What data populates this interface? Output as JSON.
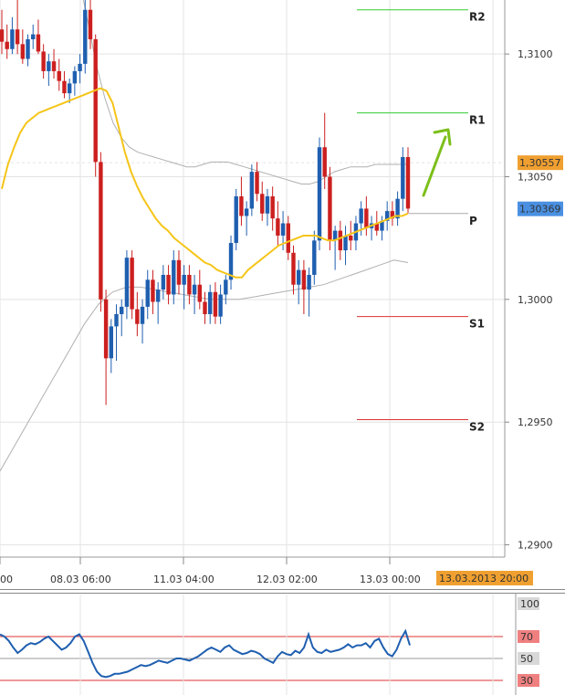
{
  "chart_data": {
    "type": "candlestick",
    "main_panel": {
      "y_axis_labels": [
        "1,3100",
        "1,3050",
        "1,3000",
        "1,2950",
        "1,2900"
      ],
      "y_axis_values": [
        1.31,
        1.305,
        1.3,
        1.295,
        1.29
      ],
      "ylim": [
        1.2895,
        1.3122
      ],
      "x_axis_labels": [
        "00",
        "08.03 06:00",
        "11.03 04:00",
        "12.03 02:00",
        "13.03 00:00"
      ],
      "current_time_label": "13.03.2013 20:00",
      "price_badges": [
        {
          "label": "1,30557",
          "value": 1.30557,
          "color": "#f0a030"
        },
        {
          "label": "1,30369",
          "value": 1.30369,
          "color": "#4a90e2"
        }
      ],
      "pivot_levels": [
        {
          "name": "R2",
          "value": 1.3118,
          "color": "#33cc33"
        },
        {
          "name": "R1",
          "value": 1.3076,
          "color": "#33cc33"
        },
        {
          "name": "P",
          "value": 1.3035,
          "color": "#aaaaaa"
        },
        {
          "name": "S1",
          "value": 1.2993,
          "color": "#dd3333"
        },
        {
          "name": "S2",
          "value": 1.2951,
          "color": "#dd3333"
        }
      ],
      "candles_ohlc": [
        [
          1.311,
          1.3118,
          1.31,
          1.3105
        ],
        [
          1.3105,
          1.3112,
          1.3098,
          1.3102
        ],
        [
          1.3102,
          1.3115,
          1.31,
          1.311
        ],
        [
          1.311,
          1.3122,
          1.31,
          1.3104
        ],
        [
          1.3104,
          1.311,
          1.3096,
          1.3098
        ],
        [
          1.3098,
          1.3108,
          1.3095,
          1.3106
        ],
        [
          1.3106,
          1.3112,
          1.3102,
          1.3108
        ],
        [
          1.3108,
          1.3114,
          1.31,
          1.3101
        ],
        [
          1.3101,
          1.3104,
          1.309,
          1.3093
        ],
        [
          1.3093,
          1.31,
          1.3087,
          1.3097
        ],
        [
          1.3097,
          1.3102,
          1.309,
          1.3093
        ],
        [
          1.3093,
          1.3098,
          1.3085,
          1.3089
        ],
        [
          1.3089,
          1.3093,
          1.3082,
          1.3084
        ],
        [
          1.3084,
          1.309,
          1.308,
          1.3088
        ],
        [
          1.3088,
          1.3095,
          1.3083,
          1.3093
        ],
        [
          1.3093,
          1.31,
          1.3088,
          1.3096
        ],
        [
          1.3096,
          1.3122,
          1.3092,
          1.3118
        ],
        [
          1.3118,
          1.3122,
          1.3102,
          1.3106
        ],
        [
          1.3106,
          1.3108,
          1.305,
          1.3056
        ],
        [
          1.3056,
          1.306,
          1.2995,
          1.3
        ],
        [
          1.3,
          1.3004,
          1.2957,
          1.2976
        ],
        [
          1.2976,
          1.2992,
          1.297,
          1.2989
        ],
        [
          1.2989,
          1.2998,
          1.2975,
          1.2994
        ],
        [
          1.2994,
          1.3,
          1.2985,
          1.2997
        ],
        [
          1.2997,
          1.302,
          1.2992,
          1.3017
        ],
        [
          1.3017,
          1.302,
          1.2992,
          1.2996
        ],
        [
          1.2996,
          1.3003,
          1.2985,
          1.299
        ],
        [
          1.299,
          1.3,
          1.2982,
          1.2997
        ],
        [
          1.2997,
          1.3012,
          1.2992,
          1.3008
        ],
        [
          1.3008,
          1.3012,
          1.2994,
          1.2999
        ],
        [
          1.2999,
          1.3007,
          1.299,
          1.3004
        ],
        [
          1.3004,
          1.3014,
          1.3,
          1.301
        ],
        [
          1.301,
          1.3014,
          1.2998,
          1.3002
        ],
        [
          1.3002,
          1.302,
          1.2998,
          1.3016
        ],
        [
          1.3016,
          1.302,
          1.3002,
          1.3006
        ],
        [
          1.3006,
          1.3014,
          1.2996,
          1.301
        ],
        [
          1.301,
          1.3014,
          1.2998,
          1.3002
        ],
        [
          1.3002,
          1.301,
          1.2994,
          1.3006
        ],
        [
          1.3006,
          1.3012,
          1.2996,
          1.2999
        ],
        [
          1.2999,
          1.3003,
          1.299,
          1.2994
        ],
        [
          1.2994,
          1.3006,
          1.299,
          1.3003
        ],
        [
          1.3003,
          1.3007,
          1.299,
          1.2993
        ],
        [
          1.2993,
          1.3006,
          1.299,
          1.3002
        ],
        [
          1.3002,
          1.301,
          1.2998,
          1.3008
        ],
        [
          1.3008,
          1.3026,
          1.3004,
          1.3023
        ],
        [
          1.3023,
          1.3045,
          1.302,
          1.3042
        ],
        [
          1.3042,
          1.305,
          1.303,
          1.3034
        ],
        [
          1.3034,
          1.304,
          1.3026,
          1.3037
        ],
        [
          1.3037,
          1.3055,
          1.3034,
          1.3052
        ],
        [
          1.3052,
          1.3056,
          1.304,
          1.3043
        ],
        [
          1.3043,
          1.3048,
          1.3032,
          1.3035
        ],
        [
          1.3035,
          1.3045,
          1.303,
          1.3042
        ],
        [
          1.3042,
          1.3046,
          1.3028,
          1.3033
        ],
        [
          1.3033,
          1.304,
          1.3022,
          1.3026
        ],
        [
          1.3026,
          1.3036,
          1.302,
          1.3031
        ],
        [
          1.3031,
          1.3034,
          1.3016,
          1.3019
        ],
        [
          1.3019,
          1.3022,
          1.3002,
          1.3006
        ],
        [
          1.3006,
          1.3016,
          1.2998,
          1.3012
        ],
        [
          1.3012,
          1.3016,
          1.2994,
          1.3004
        ],
        [
          1.3004,
          1.3013,
          1.2993,
          1.301
        ],
        [
          1.301,
          1.3028,
          1.3006,
          1.3024
        ],
        [
          1.3024,
          1.3066,
          1.302,
          1.3062
        ],
        [
          1.3062,
          1.3076,
          1.3045,
          1.305
        ],
        [
          1.305,
          1.3054,
          1.302,
          1.3024
        ],
        [
          1.3024,
          1.303,
          1.3012,
          1.3028
        ],
        [
          1.3028,
          1.3032,
          1.3016,
          1.302
        ],
        [
          1.302,
          1.303,
          1.3014,
          1.3026
        ],
        [
          1.3026,
          1.3032,
          1.302,
          1.3024
        ],
        [
          1.3024,
          1.3034,
          1.302,
          1.3031
        ],
        [
          1.3031,
          1.304,
          1.3026,
          1.3037
        ],
        [
          1.3037,
          1.3042,
          1.3026,
          1.3029
        ],
        [
          1.3029,
          1.3034,
          1.3024,
          1.3031
        ],
        [
          1.3031,
          1.3036,
          1.3026,
          1.3028
        ],
        [
          1.3028,
          1.3034,
          1.3024,
          1.3032
        ],
        [
          1.3032,
          1.304,
          1.3028,
          1.3036
        ],
        [
          1.3036,
          1.304,
          1.303,
          1.3033
        ],
        [
          1.3033,
          1.3044,
          1.303,
          1.3041
        ],
        [
          1.3041,
          1.3062,
          1.3036,
          1.3058
        ],
        [
          1.3058,
          1.3062,
          1.3035,
          1.3037
        ]
      ],
      "moving_average": [
        1.3045,
        1.3055,
        1.3062,
        1.3068,
        1.3072,
        1.3074,
        1.3076,
        1.3077,
        1.3078,
        1.3079,
        1.308,
        1.3081,
        1.3082,
        1.3083,
        1.3084,
        1.3085,
        1.3086,
        1.3085,
        1.308,
        1.307,
        1.306,
        1.3052,
        1.3046,
        1.3041,
        1.3037,
        1.3033,
        1.303,
        1.3028,
        1.3025,
        1.3023,
        1.3021,
        1.3019,
        1.3017,
        1.3015,
        1.3014,
        1.3012,
        1.3011,
        1.301,
        1.3009,
        1.3009,
        1.3012,
        1.3014,
        1.3016,
        1.3018,
        1.302,
        1.3022,
        1.3023,
        1.3024,
        1.3025,
        1.3026,
        1.3026,
        1.3026,
        1.3025,
        1.3024,
        1.3024,
        1.3025,
        1.3026,
        1.3027,
        1.3028,
        1.3029,
        1.303,
        1.3031,
        1.3032,
        1.3033,
        1.3034,
        1.3034,
        1.3035
      ],
      "bollinger_upper": [
        1.315,
        1.314,
        1.3128,
        1.3112,
        1.3095,
        1.3082,
        1.3072,
        1.3066,
        1.3062,
        1.306,
        1.3059,
        1.3058,
        1.3057,
        1.3056,
        1.3055,
        1.3054,
        1.3054,
        1.3055,
        1.3056,
        1.3056,
        1.3056,
        1.3055,
        1.3054,
        1.3053,
        1.3052,
        1.3051,
        1.305,
        1.3049,
        1.3048,
        1.3047,
        1.3047,
        1.3048,
        1.305,
        1.3052,
        1.3053,
        1.3054,
        1.3054,
        1.3054,
        1.3055,
        1.3055,
        1.3055,
        1.3055,
        1.3055
      ],
      "bollinger_lower": [
        1.293,
        1.294,
        1.295,
        1.296,
        1.297,
        1.298,
        1.299,
        1.2998,
        1.3003,
        1.3005,
        1.3005,
        1.3004,
        1.3003,
        1.3002,
        1.3001,
        1.3,
        1.3,
        1.3,
        1.3001,
        1.3002,
        1.3003,
        1.3004,
        1.3005,
        1.3006,
        1.3008,
        1.301,
        1.3012,
        1.3014,
        1.3016,
        1.3015
      ],
      "colors": {
        "up": "#1f5fb0",
        "down": "#cc1f1f",
        "ma": "#f5c518",
        "bollinger": "#b0b0b0",
        "arrow": "#7cbf1a"
      }
    },
    "oscillator_panel": {
      "y_axis_labels": [
        "100",
        "70",
        "50",
        "30"
      ],
      "ylim": [
        30,
        100
      ],
      "levels": [
        {
          "label": "70",
          "value": 70,
          "color": "#dd3333",
          "badge_color": "#f08080"
        },
        {
          "label": "50",
          "value": 50,
          "color": "#999999",
          "badge_color": "#d8d8d8"
        },
        {
          "label": "30",
          "value": 30,
          "color": "#dd3333",
          "badge_color": "#f08080"
        }
      ],
      "badge_100_color": "#d8d8d8",
      "values": [
        72,
        70,
        66,
        60,
        55,
        58,
        62,
        64,
        63,
        65,
        68,
        70,
        66,
        62,
        58,
        60,
        64,
        70,
        72,
        66,
        56,
        46,
        38,
        34,
        33,
        34,
        36,
        36,
        37,
        38,
        40,
        42,
        44,
        43,
        44,
        46,
        48,
        47,
        46,
        48,
        50,
        50,
        49,
        48,
        50,
        52,
        55,
        58,
        60,
        58,
        56,
        60,
        62,
        58,
        56,
        54,
        55,
        57,
        56,
        54,
        50,
        48,
        46,
        52,
        56,
        54,
        53,
        57,
        55,
        60,
        72,
        60,
        56,
        55,
        58,
        56,
        57,
        58,
        60,
        63,
        60,
        62,
        62,
        64,
        60,
        66,
        68,
        60,
        54,
        52,
        58,
        68,
        75,
        62
      ],
      "line_color": "#1f5fb0"
    }
  }
}
